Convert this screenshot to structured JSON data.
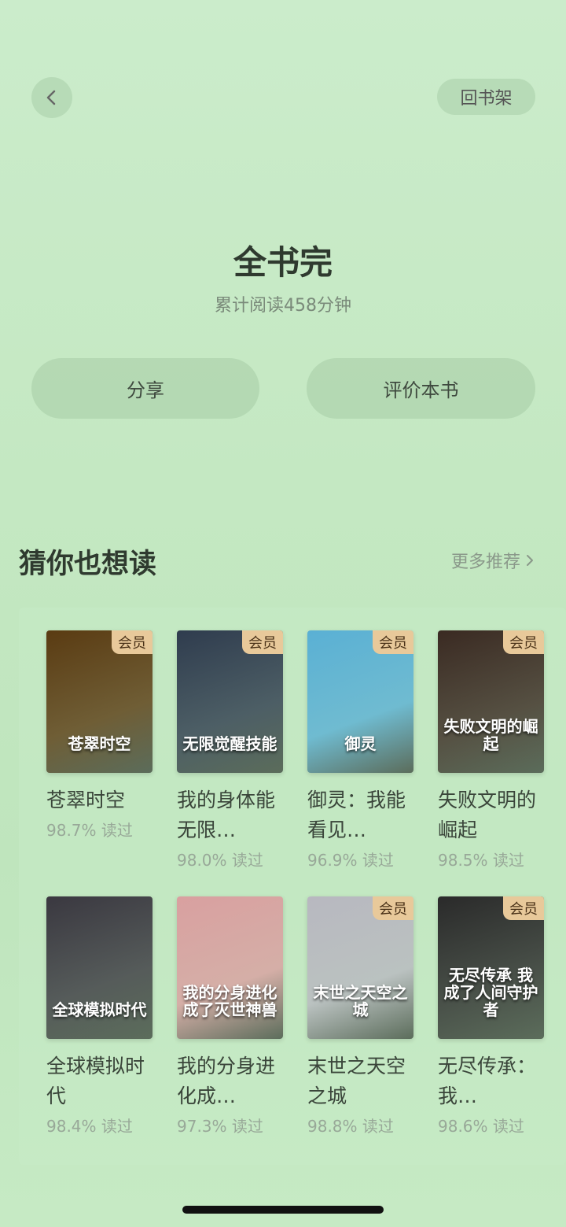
{
  "header": {
    "shelf_label": "回书架"
  },
  "finish": {
    "title": "全书完",
    "read_time": "累计阅读458分钟"
  },
  "actions": {
    "share_label": "分享",
    "review_label": "评价本书"
  },
  "recommend": {
    "title": "猜你也想读",
    "more_label": "更多推荐",
    "books": [
      {
        "title": "苍翠时空",
        "rate": "98.7% 读过",
        "badge": "会员",
        "cover_text": "苍翠时空",
        "cover_color": "#5a3b12"
      },
      {
        "title": "我的身体能无限…",
        "rate": "98.0% 读过",
        "badge": "会员",
        "cover_text": "无限觉醒技能",
        "cover_color": "#2f3c4e"
      },
      {
        "title": "御灵：我能看见…",
        "rate": "96.9% 读过",
        "badge": "会员",
        "cover_text": "御灵",
        "cover_color": "#5ab0d4"
      },
      {
        "title": "失败文明的崛起",
        "rate": "98.5% 读过",
        "badge": "会员",
        "cover_text": "失败文明的崛起",
        "cover_color": "#3a2a22"
      },
      {
        "title": "全球模拟时代",
        "rate": "98.4% 读过",
        "badge": "",
        "cover_text": "全球模拟时代",
        "cover_color": "#3a3840"
      },
      {
        "title": "我的分身进化成…",
        "rate": "97.3% 读过",
        "badge": "",
        "cover_text": "我的分身进化成了灭世神兽",
        "cover_color": "#d9a0a0"
      },
      {
        "title": "末世之天空之城",
        "rate": "98.8% 读过",
        "badge": "会员",
        "cover_text": "末世之天空之城",
        "cover_color": "#b8b8c0"
      },
      {
        "title": "无尽传承：我…",
        "rate": "98.6% 读过",
        "badge": "会员",
        "cover_text": "无尽传承 我成了人间守护者",
        "cover_color": "#2a2a2a"
      }
    ]
  },
  "icons": {
    "back": "chevron-left-icon",
    "more": "chevron-right-icon"
  }
}
